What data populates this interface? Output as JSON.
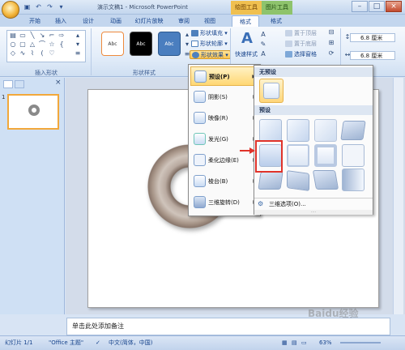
{
  "window": {
    "title": "演示文稿1 - Microsoft PowerPoint",
    "context_tab_draw": "绘图工具",
    "context_tab_pic": "图片工具",
    "controls": {
      "minimize": "–",
      "maximize": "□",
      "close": "×"
    }
  },
  "tabs": [
    "开始",
    "插入",
    "设计",
    "动画",
    "幻灯片放映",
    "审阅",
    "视图",
    "格式",
    "格式"
  ],
  "active_tab_index": 7,
  "ribbon": {
    "group_insert_shapes": "插入形状",
    "group_shape_styles": "形状样式",
    "style_sample": "Abc",
    "fill_label": "形状填充",
    "outline_label": "形状轮廓",
    "effect_label": "形状效果",
    "quick_styles_label": "快速样式",
    "arrange_front": "置于顶层",
    "arrange_back": "置于底层",
    "selection_pane": "选择窗格",
    "height_value": "6.8 厘米",
    "width_value": "6.8 厘米"
  },
  "effects_menu": [
    {
      "label": "预设(P)",
      "active": true
    },
    {
      "label": "阴影(S)",
      "active": false
    },
    {
      "label": "映像(R)",
      "active": false
    },
    {
      "label": "发光(G)",
      "active": false
    },
    {
      "label": "柔化边缘(E)",
      "active": false
    },
    {
      "label": "棱台(B)",
      "active": false
    },
    {
      "label": "三维旋转(D)",
      "active": false
    }
  ],
  "preset_submenu": {
    "no_preset_header": "无预设",
    "preset_header": "预设",
    "three_d_options": "三维选项(O)...",
    "grip": "····"
  },
  "notes_placeholder": "单击此处添加备注",
  "status": {
    "slide_info": "幻灯片 1/1",
    "theme": "\"Office 主题\"",
    "language": "中文(简体，中国)",
    "zoom": "63%"
  },
  "watermark": "Baidu经验"
}
